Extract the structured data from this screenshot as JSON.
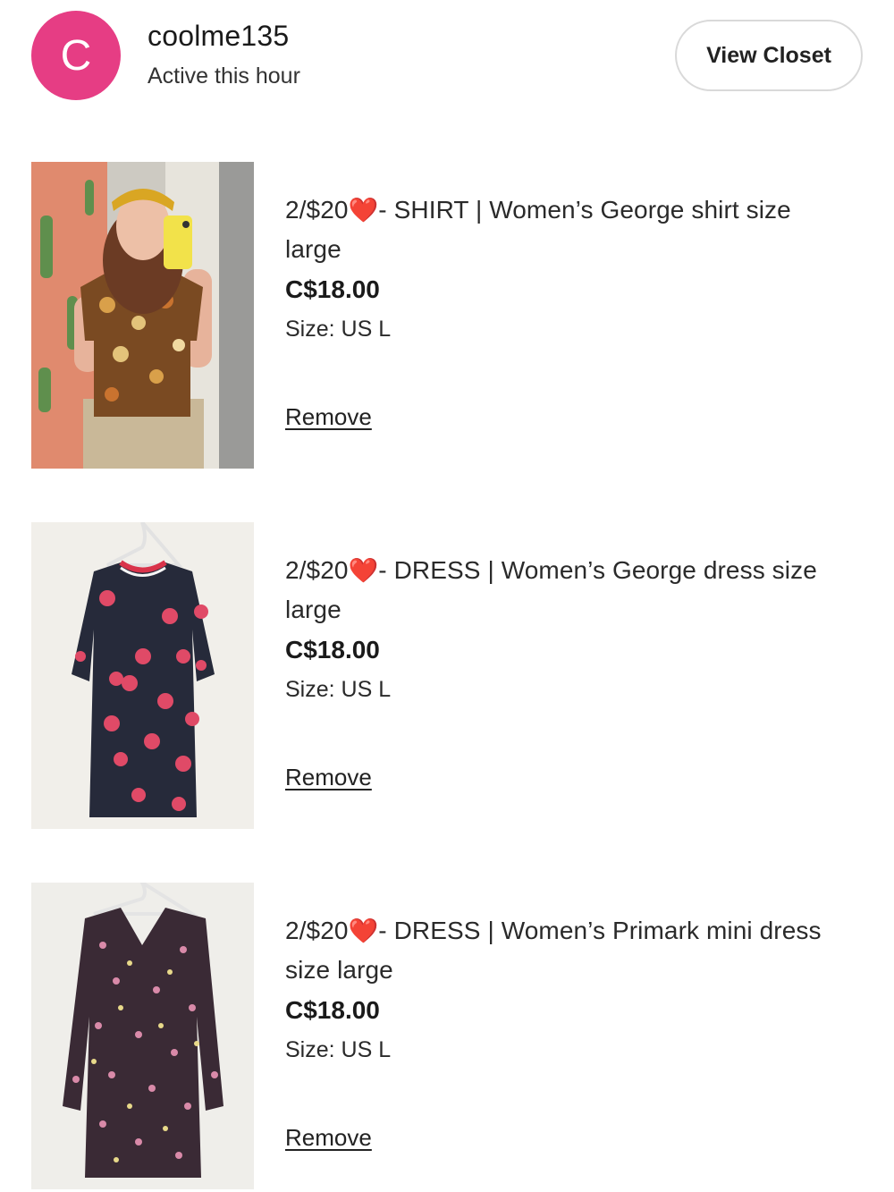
{
  "seller": {
    "avatar_letter": "C",
    "avatar_color": "#e63d84",
    "username": "coolme135",
    "activity": "Active this hour",
    "view_closet_label": "View Closet"
  },
  "listings": [
    {
      "title_prefix": "2/$20",
      "heart": "❤️",
      "title_rest": "- SHIRT | Women’s George shirt size large",
      "price": "C$18.00",
      "size": "Size: US L",
      "remove_label": "Remove"
    },
    {
      "title_prefix": "2/$20",
      "heart": "❤️",
      "title_rest": "- DRESS | Women’s George dress size large",
      "price": "C$18.00",
      "size": "Size: US L",
      "remove_label": "Remove"
    },
    {
      "title_prefix": "2/$20",
      "heart": "❤️",
      "title_rest": "- DRESS | Women’s Primark mini dress size large",
      "price": "C$18.00",
      "size": "Size: US L",
      "remove_label": "Remove"
    }
  ]
}
